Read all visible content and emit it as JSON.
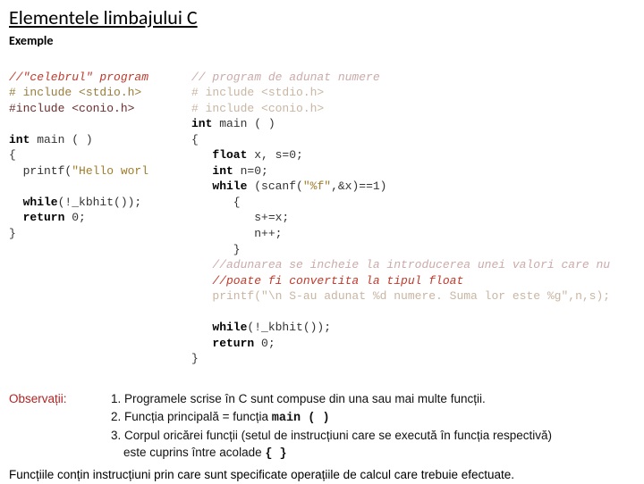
{
  "title": "Elementele limbajului C",
  "subtitle": "Exemple",
  "code_left": {
    "l1": "//\"celebrul\" program",
    "l2": "# include <stdio.h>",
    "l3": "#include <conio.h>",
    "l4": "",
    "l5a": "int",
    "l5b": " main ( )",
    "l6": "{",
    "l7a": "  printf(",
    "l7b": "\"Hello worl",
    "l8": "",
    "l9a": "  while",
    "l9b": "(!_kbhit());",
    "l10a": "  return",
    "l10b": " 0;",
    "l11": "}"
  },
  "code_right": {
    "l1": "// program de adunat numere",
    "l2": "# include <stdio.h>",
    "l3": "# include <conio.h>",
    "l4a": "int",
    "l4b": " main ( )",
    "l5": "{",
    "l6a": "   float",
    "l6b": " x, s=0;",
    "l7a": "   int",
    "l7b": " n=0;",
    "l8a": "   while",
    "l8b": " (scanf(",
    "l8c": "\"%f\"",
    "l8d": ",&x)==1)",
    "l9": "      {",
    "l10": "         s+=x;",
    "l11": "         n++;",
    "l12": "      }",
    "l13": "   //adunarea se incheie la introducerea unei valori care nu",
    "l14": "   //poate fi convertita la tipul float",
    "l15a": "   printf(",
    "l15b": "\"\\n S-au adunat %d numere. Suma lor este %g\"",
    "l15c": ",n,s);",
    "l16": "",
    "l17a": "   while",
    "l17b": "(!_kbhit());",
    "l18a": "   return",
    "l18b": " 0;",
    "l19": "}"
  },
  "observations": {
    "label": "Observații:",
    "items": [
      {
        "n": "1.",
        "text": "Programele scrise în C sunt compuse din una sau mai multe funcții."
      },
      {
        "n": "2.",
        "text_a": "Funcția principală = funcția ",
        "code": "main ( )"
      },
      {
        "n": "3.",
        "text_a": "Corpul oricărei funcții (setul de instrucțiuni care se execută în funcția  respectivă)",
        "text_b": "este cuprins între  acolade  ",
        "code": "{     }"
      }
    ]
  },
  "final": "Funcțiile conțin instrucțiuni prin care sunt specificate operațiile de calcul care trebuie efectuate."
}
